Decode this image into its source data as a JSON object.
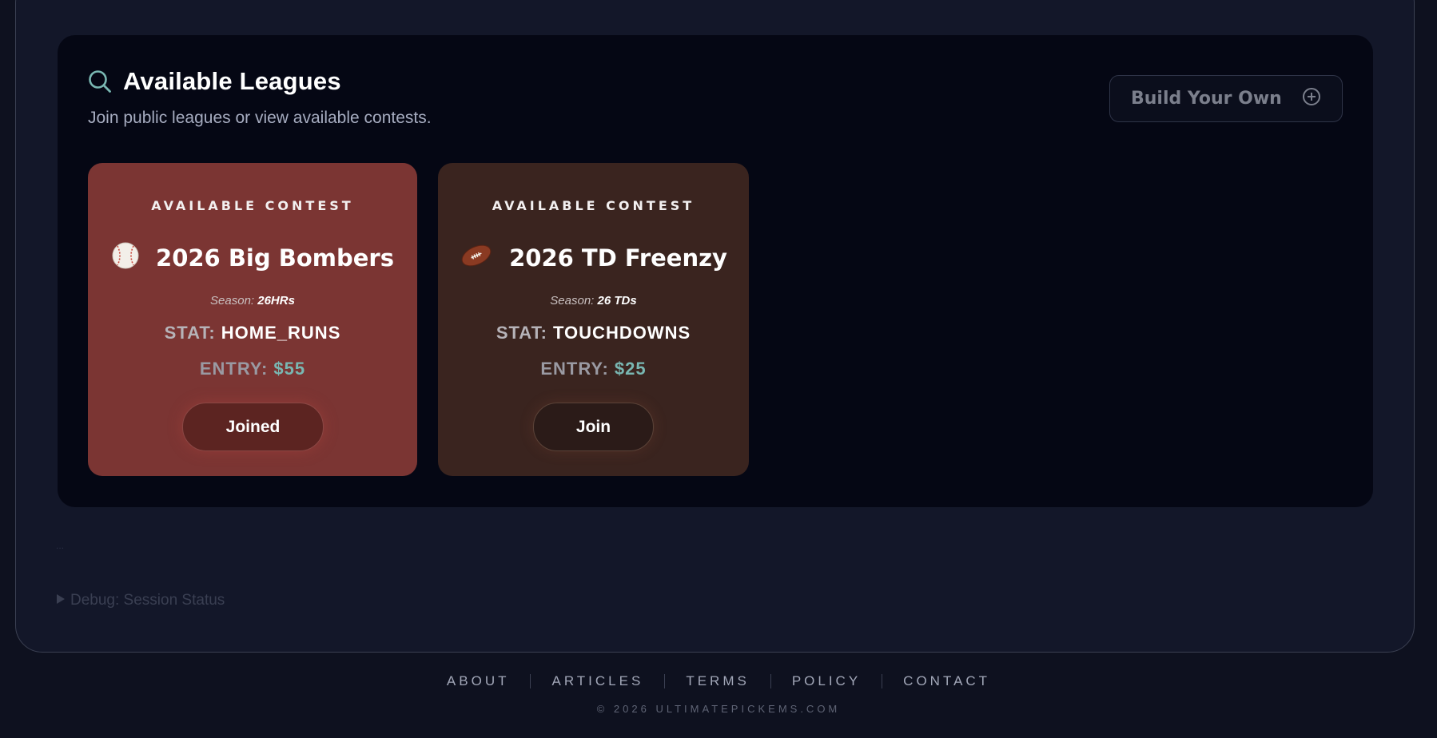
{
  "header": {
    "title": "Available Leagues",
    "subtitle": "Join public leagues or view available contests.",
    "build_button_label": "Build Your Own"
  },
  "contests": [
    {
      "eyebrow": "AVAILABLE CONTEST",
      "icon": "baseball-icon",
      "title": "2026 Big Bombers",
      "season_label": "Season:",
      "season_value": "26HRs",
      "stat_label": "STAT:",
      "stat_value": "HOME_RUNS",
      "entry_label": "ENTRY:",
      "entry_value": "$55",
      "button_label": "Joined",
      "background": "#7b3533"
    },
    {
      "eyebrow": "AVAILABLE CONTEST",
      "icon": "football-icon",
      "title": "2026 TD Freenzy",
      "season_label": "Season:",
      "season_value": "26 TDs",
      "stat_label": "STAT:",
      "stat_value": "TOUCHDOWNS",
      "entry_label": "ENTRY:",
      "entry_value": "$25",
      "button_label": "Join",
      "background": "#3a241f"
    }
  ],
  "dots": "...",
  "debug": {
    "label": "Debug: Session Status"
  },
  "footer": {
    "links": [
      "ABOUT",
      "ARTICLES",
      "TERMS",
      "POLICY",
      "CONTACT"
    ],
    "copyright": "© 2026 ULTIMATEPICKEMS.COM"
  },
  "colors": {
    "background": "#0e111f",
    "panel": "#050714",
    "accent_teal": "#79b7b2"
  }
}
